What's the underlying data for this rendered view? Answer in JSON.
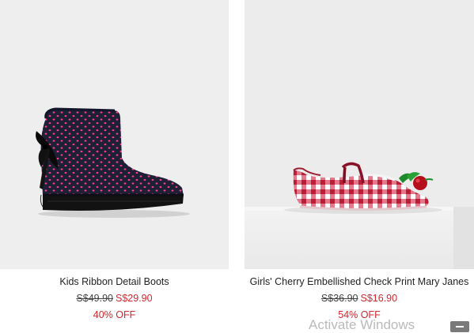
{
  "products": [
    {
      "name": "Kids Ribbon Detail Boots",
      "original_price": "S$49.90",
      "sale_price": "S$29.90",
      "discount": "40% OFF"
    },
    {
      "name": "Girls' Cherry Embellished Check Print Mary Janes",
      "original_price": "S$36.90",
      "sale_price": "S$16.90",
      "discount": "54% OFF"
    }
  ],
  "watermark": "Activate Windows",
  "colors": {
    "sale": "#d0282e",
    "text": "#222222"
  },
  "icons": {
    "scroll_button": "minus-icon"
  }
}
